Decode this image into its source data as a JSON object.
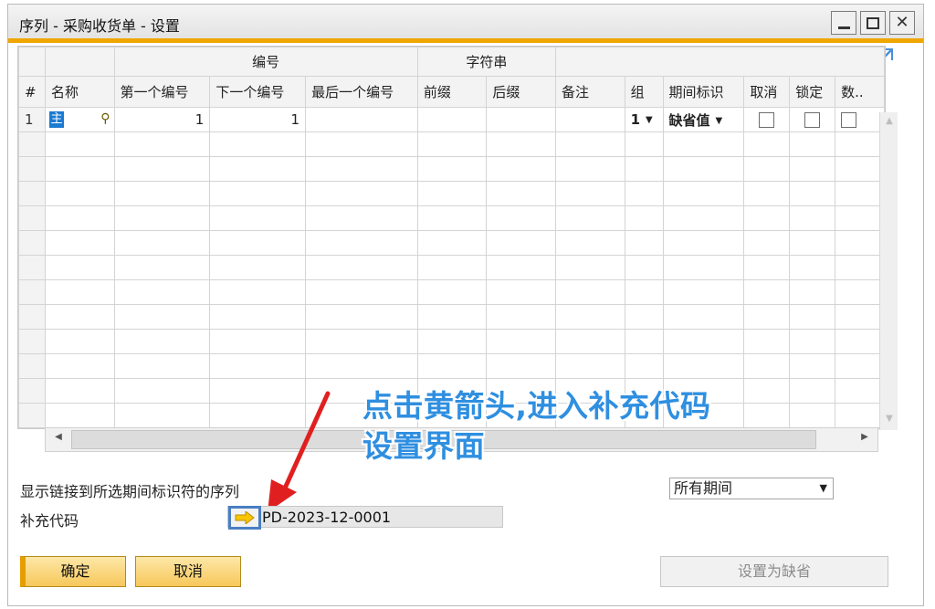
{
  "window": {
    "title": "序列 - 采购收货单 - 设置"
  },
  "grid": {
    "group_headers": {
      "number": "编号",
      "string": "字符串"
    },
    "columns": [
      "#",
      "名称",
      "第一个编号",
      "下一个编号",
      "最后一个编号",
      "前缀",
      "后缀",
      "备注",
      "组",
      "期间标识",
      "取消",
      "锁定",
      "数.."
    ],
    "rows": [
      {
        "row_num": "1",
        "name_marker": "主",
        "first": "1",
        "next": "1",
        "last": "",
        "prefix": "",
        "suffix": "",
        "remark": "",
        "group": "1",
        "period": "缺省值",
        "cancel": false,
        "locked": false
      }
    ]
  },
  "annotation": {
    "line1": "点击黄箭头,进入补充代码",
    "line2": "设置界面",
    "color": "#2f8fe0",
    "arrow_color": "#e02020"
  },
  "footer": {
    "show_linked_label": "显示链接到所选期间标识符的序列",
    "period_select_value": "所有期间",
    "supplement_code_label": "补充代码",
    "supplement_code_value": "PD-2023-12-0001",
    "ok_label": "确定",
    "cancel_label": "取消",
    "set_default_label": "设置为缺省"
  },
  "colors": {
    "accent": "#f0a500",
    "selection_blue": "#1c7ad1"
  }
}
